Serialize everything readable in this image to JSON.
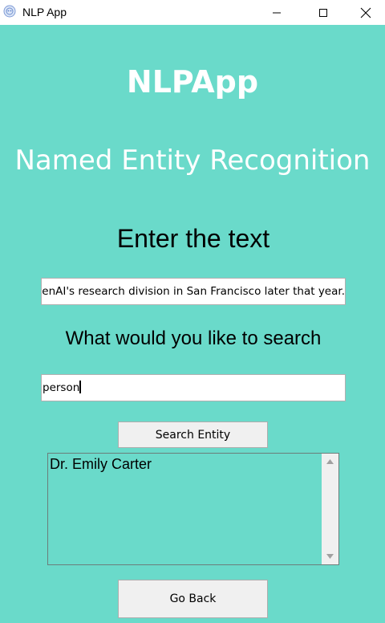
{
  "window": {
    "title": "NLP App",
    "icon": "app-icon",
    "controls": [
      "minimize-icon",
      "maximize-icon",
      "close-icon"
    ]
  },
  "main": {
    "app_title": "NLPApp",
    "subtitle": "Named Entity Recognition",
    "enter_label": "Enter the text",
    "text_value": "penAI's research division in San Francisco later that year.",
    "search_label": "What would you like to search",
    "search_value": "person",
    "search_button": "Search Entity",
    "results": [
      "Dr. Emily Carter"
    ],
    "back_button": "Go Back"
  },
  "colors": {
    "background": "#6adaca",
    "button": "#f0f0f0",
    "heading_text": "#ffffff"
  }
}
